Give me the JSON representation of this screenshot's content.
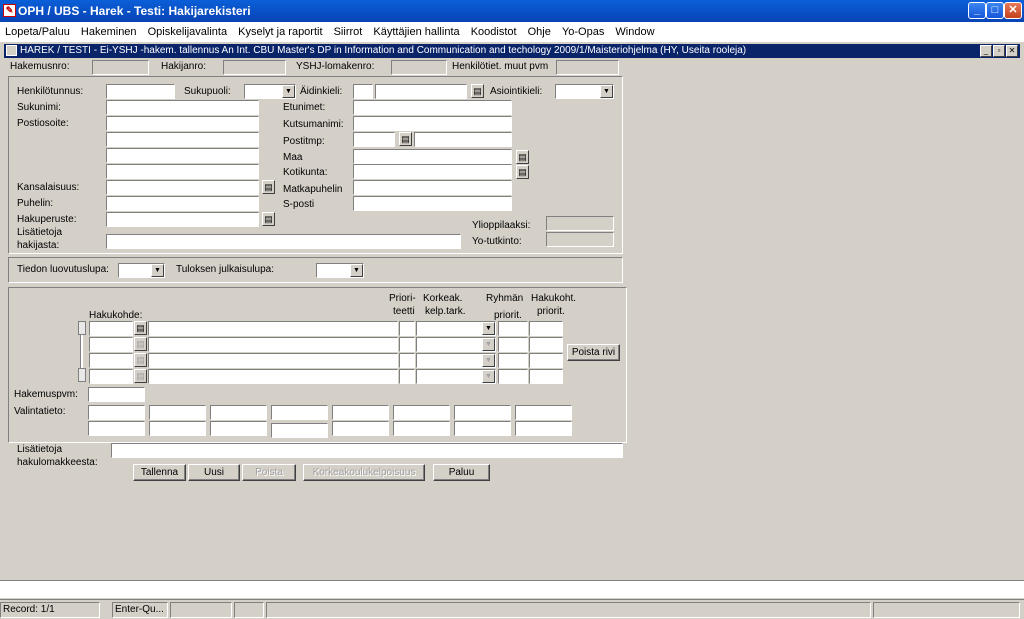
{
  "app": {
    "title": "OPH / UBS - Harek - Testi: Hakijarekisteri",
    "icon_label": "OPH-icon"
  },
  "window_buttons": [
    "_",
    "□",
    "✕"
  ],
  "menu": [
    "Lopeta/Paluu",
    "Hakeminen",
    "Opiskelijavalinta",
    "Kyselyt ja raportit",
    "Siirrot",
    "Käyttäjien hallinta",
    "Koodistot",
    "Ohje",
    "Yo-Opas",
    "Window"
  ],
  "child": {
    "title": "HAREK / TESTI - Ei-YSHJ -hakem. tallennus An Int. CBU Master's DP in Information and Communication and techology 2009/1/Maisteriohjelma  (HY, Useita rooleja)"
  },
  "header": {
    "hakemusnro": "Hakemusnro:",
    "hakijanro": "Hakijanro:",
    "yshj": "YSHJ-lomakenro:",
    "henkilotiet": "Henkilötiet. muut pvm"
  },
  "person": {
    "henkilotunnus": "Henkilötunnus:",
    "sukupuoli": "Sukupuoli:",
    "aidinkieli": "Äidinkieli:",
    "asiointikieli": "Asiointikieli:",
    "sukunimi": "Sukunimi:",
    "etunimet": "Etunimet:",
    "postiosoite": "Postiosoite:",
    "kutsumanimi": "Kutsumanimi:",
    "postitmp": "Postitmp:",
    "maa": "Maa",
    "kotikunta": "Kotikunta:",
    "kansalaisuus": "Kansalaisuus:",
    "matkapuhelin": "Matkapuhelin",
    "puhelin": "Puhelin:",
    "sposti": "S-posti",
    "hakuperuste": "Hakuperuste:",
    "lisatietoja": "Lisätietoja",
    "hakijasta": "hakijasta:",
    "ylioppilaaksi": "Ylioppilaaksi:",
    "yotutkinto": "Yo-tutkinto:"
  },
  "permits": {
    "tiedon": "Tiedon luovutuslupa:",
    "tuloksen": "Tuloksen julkaisulupa:"
  },
  "hakukohde": {
    "title": "Hakukohde:",
    "prioriteetti1": "Priori-",
    "prioriteetti2": "teetti",
    "korkeak1": "Korkeak.",
    "korkeak2": "kelp.tark.",
    "ryhman1": "Ryhmän",
    "ryhman2": "priorit.",
    "hakukoht1": "Hakukoht.",
    "hakukoht2": "priorit.",
    "poista_rivi": "Poista rivi",
    "hakemuspvm": "Hakemuspvm:",
    "valintatieto": "Valintatieto:",
    "lisatietoja1": "Lisätietoja",
    "lisatietoja2": "hakulomakkeesta:"
  },
  "buttons": {
    "tallenna": "Tallenna",
    "uusi": "Uusi",
    "poista": "Poista",
    "korkeakoulu": "Korkeakoulukelpoisuus",
    "paluu": "Paluu"
  },
  "status": {
    "record": "Record: 1/1",
    "mode": "Enter-Qu..."
  }
}
